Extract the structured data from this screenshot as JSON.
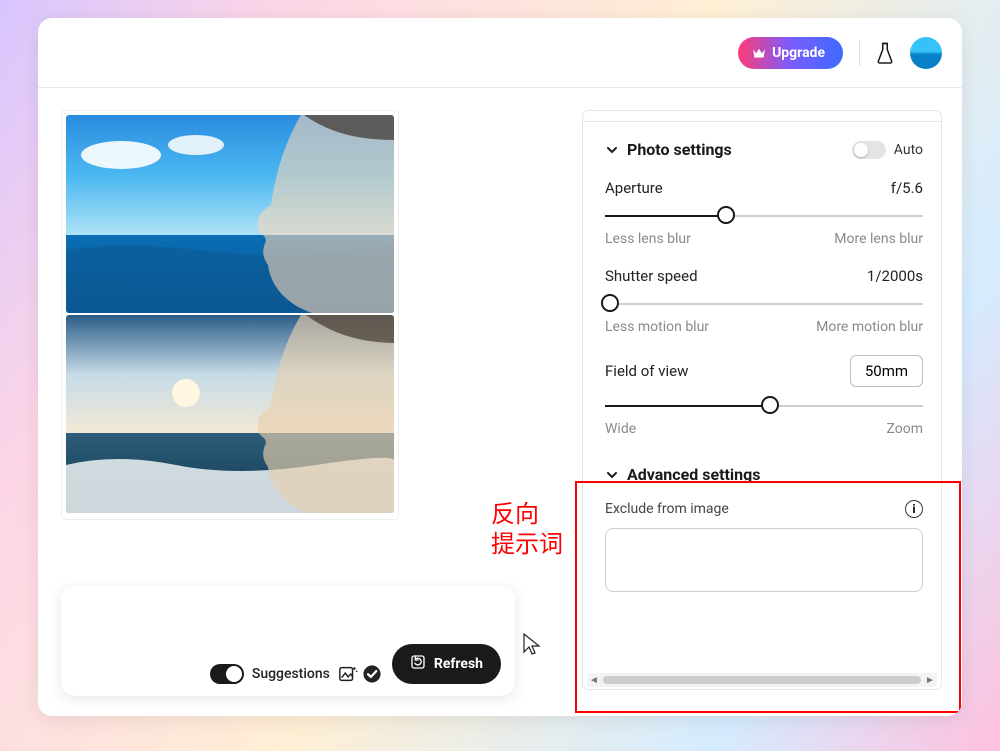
{
  "topbar": {
    "upgrade_label": "Upgrade"
  },
  "bottom": {
    "suggestions_label": "Suggestions",
    "refresh_label": "Refresh"
  },
  "annotation": {
    "line1": "反向",
    "line2": "提示词"
  },
  "panel": {
    "photo": {
      "title": "Photo settings",
      "auto_label": "Auto",
      "aperture": {
        "label": "Aperture",
        "value": "f/5.6",
        "min_hint": "Less lens blur",
        "max_hint": "More lens blur",
        "pos": 38
      },
      "shutter": {
        "label": "Shutter speed",
        "value": "1/2000s",
        "min_hint": "Less motion blur",
        "max_hint": "More motion blur",
        "pos": 0
      },
      "fov": {
        "label": "Field of view",
        "value": "50mm",
        "min_hint": "Wide",
        "max_hint": "Zoom",
        "pos": 52
      }
    },
    "advanced": {
      "title": "Advanced settings",
      "exclude_label": "Exclude from image",
      "exclude_value": ""
    }
  }
}
